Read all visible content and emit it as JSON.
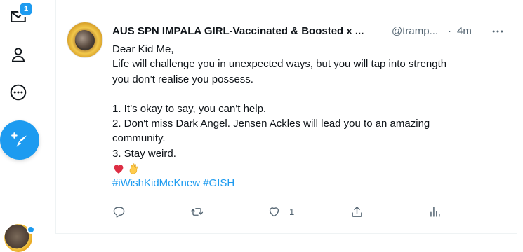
{
  "nav": {
    "notification_badge": "1",
    "icons": [
      "mail-icon",
      "profile-icon",
      "more-circle-icon",
      "compose-tweet-icon"
    ]
  },
  "tweet": {
    "display_name": "AUS SPN IMPALA GIRL-Vaccinated & Boosted x ...",
    "handle": "@tramp...",
    "separator": "·",
    "time": "4m",
    "lines": [
      "Dear Kid Me,",
      "Life will challenge you in unexpected ways, but you will tap into strength",
      "you don’t realise you possess.",
      "",
      "1. It’s okay to say, you can't help.",
      "2. Don't miss Dark Angel. Jensen Ackles will lead you to an amazing",
      "community.",
      "3. Stay weird."
    ],
    "emojis": [
      "red-heart",
      "pinched-fingers"
    ],
    "hashtags": [
      "#iWishKidMeKnew",
      "#GISH"
    ],
    "like_count": "1"
  },
  "colors": {
    "accent": "#1d9bf0",
    "text": "#0f1419",
    "muted": "#536471",
    "heart": "#e0245e",
    "divider": "#eff3f4"
  }
}
